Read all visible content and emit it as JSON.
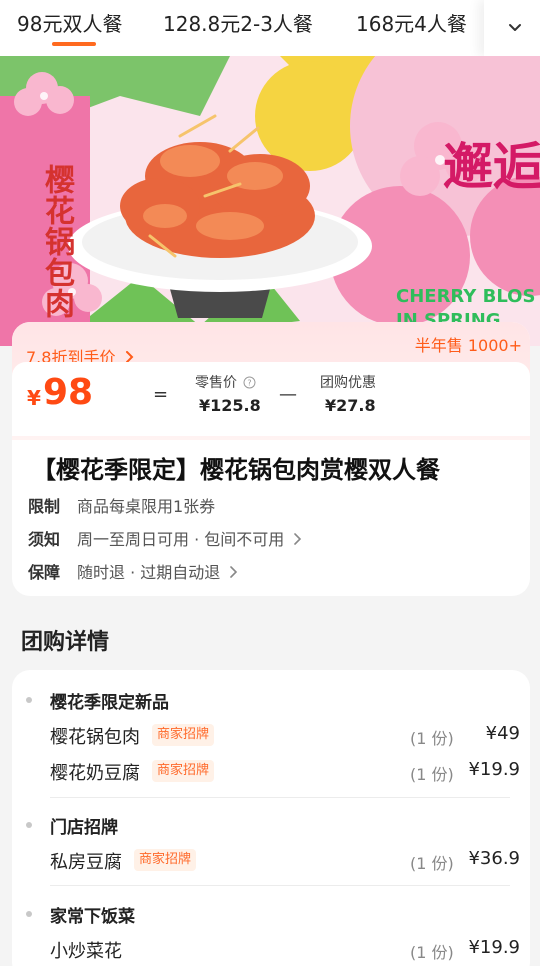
{
  "tabs": [
    {
      "label": "98元双人餐"
    },
    {
      "label": "128.8元2-3人餐"
    },
    {
      "label": "168元4人餐"
    }
  ],
  "banner": {
    "dish_name": "樱花锅包肉",
    "headline": "邂逅的",
    "english": "CHERRY BLOS\nIN SPRING"
  },
  "price": {
    "discount_tag": "7.8折到手价",
    "sold": "半年售 1000+",
    "currency": "¥",
    "amount": "98",
    "equals": "=",
    "minus": "—",
    "retail_label": "零售价",
    "retail_value": "¥125.8",
    "group_label": "团购优惠",
    "group_value": "¥27.8"
  },
  "deal": {
    "title": "【樱花季限定】樱花锅包肉赏樱双人餐",
    "rows": [
      {
        "key": "限制",
        "value": "商品每桌限用1张券"
      },
      {
        "key": "须知",
        "value": "周一至周日可用 · 包间不可用"
      },
      {
        "key": "保障",
        "value": "随时退 · 过期自动退"
      }
    ]
  },
  "details": {
    "section_title": "团购详情",
    "groups": [
      {
        "name": "樱花季限定新品",
        "items": [
          {
            "name": "樱花锅包肉",
            "badge": "商家招牌",
            "qty": "(1 份)",
            "price": "¥49"
          },
          {
            "name": "樱花奶豆腐",
            "badge": "商家招牌",
            "qty": "(1 份)",
            "price": "¥19.9"
          }
        ]
      },
      {
        "name": "门店招牌",
        "items": [
          {
            "name": "私房豆腐",
            "badge": "商家招牌",
            "qty": "(1 份)",
            "price": "¥36.9"
          }
        ]
      },
      {
        "name": "家常下饭菜",
        "items": [
          {
            "name": "小炒菜花",
            "qty": "(1 份)",
            "price": "¥19.9"
          }
        ]
      }
    ]
  },
  "colors": {
    "accent": "#ff5c1a",
    "banner_pink": "#f07aa8",
    "banner_green": "#2fbd5b"
  }
}
